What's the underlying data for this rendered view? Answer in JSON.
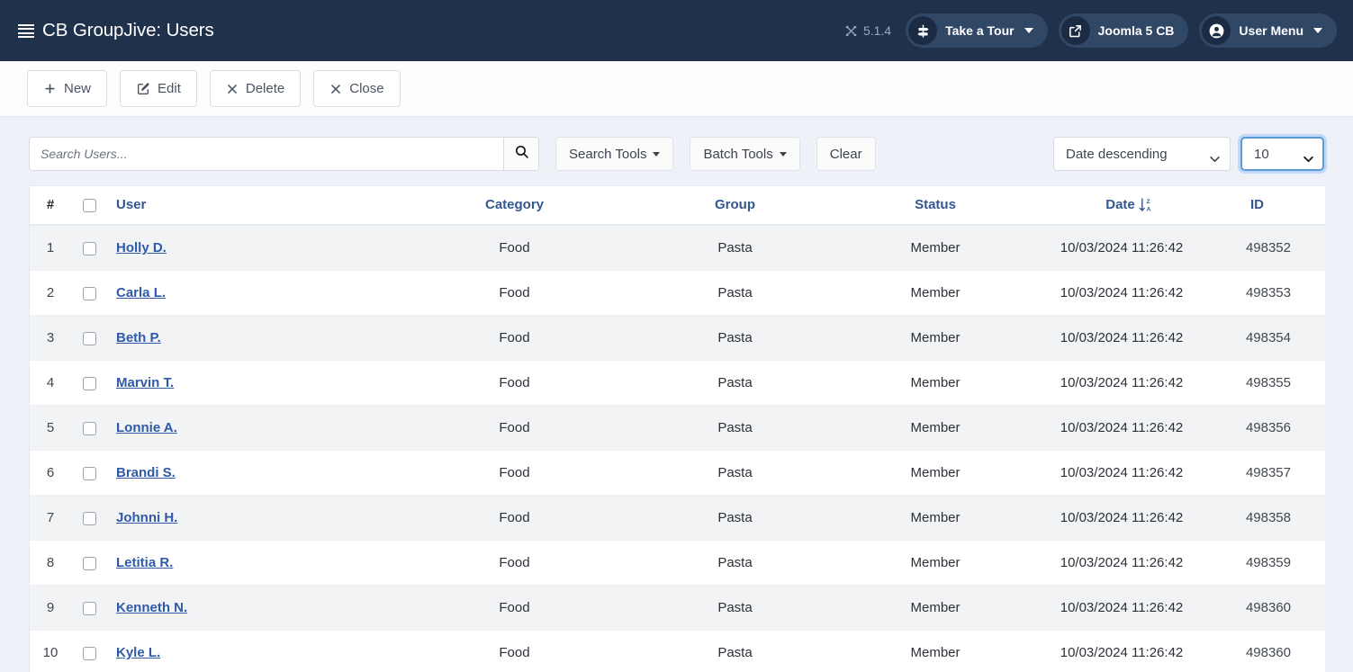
{
  "header": {
    "title": "CB GroupJive: Users",
    "menu_icon": "hamburger-icon",
    "version": "5.1.4",
    "pills": [
      {
        "label": "Take a Tour",
        "icon": "signpost-icon",
        "caret": true
      },
      {
        "label": "Joomla 5 CB",
        "icon": "external-link-icon",
        "caret": false
      },
      {
        "label": "User Menu",
        "icon": "user-circle-icon",
        "caret": true
      }
    ]
  },
  "toolbar": {
    "new_label": "New",
    "edit_label": "Edit",
    "delete_label": "Delete",
    "close_label": "Close"
  },
  "filters": {
    "search_value": "",
    "search_placeholder": "Search Users...",
    "search_button_icon": "search-icon",
    "search_tools_label": "Search Tools",
    "batch_tools_label": "Batch Tools",
    "clear_label": "Clear",
    "sort_selected": "Date descending",
    "sort_options": [
      "Date descending"
    ],
    "limit_selected": "10",
    "limit_options": [
      "10"
    ]
  },
  "table": {
    "columns": {
      "number": "#",
      "select_all": "",
      "user": "User",
      "category": "Category",
      "group": "Group",
      "status": "Status",
      "date": "Date",
      "id": "ID"
    },
    "sorted_column": "Date",
    "sort_direction": "descending",
    "sort_icon": "sort-z-a-icon",
    "rows": [
      {
        "num": "1",
        "user": "Holly D.",
        "category": "Food",
        "group": "Pasta",
        "status": "Member",
        "date": "10/03/2024 11:26:42",
        "id": "498352"
      },
      {
        "num": "2",
        "user": "Carla L.",
        "category": "Food",
        "group": "Pasta",
        "status": "Member",
        "date": "10/03/2024 11:26:42",
        "id": "498353"
      },
      {
        "num": "3",
        "user": "Beth P.",
        "category": "Food",
        "group": "Pasta",
        "status": "Member",
        "date": "10/03/2024 11:26:42",
        "id": "498354"
      },
      {
        "num": "4",
        "user": "Marvin T.",
        "category": "Food",
        "group": "Pasta",
        "status": "Member",
        "date": "10/03/2024 11:26:42",
        "id": "498355"
      },
      {
        "num": "5",
        "user": "Lonnie A.",
        "category": "Food",
        "group": "Pasta",
        "status": "Member",
        "date": "10/03/2024 11:26:42",
        "id": "498356"
      },
      {
        "num": "6",
        "user": "Brandi S.",
        "category": "Food",
        "group": "Pasta",
        "status": "Member",
        "date": "10/03/2024 11:26:42",
        "id": "498357"
      },
      {
        "num": "7",
        "user": "Johnni H.",
        "category": "Food",
        "group": "Pasta",
        "status": "Member",
        "date": "10/03/2024 11:26:42",
        "id": "498358"
      },
      {
        "num": "8",
        "user": "Letitia R.",
        "category": "Food",
        "group": "Pasta",
        "status": "Member",
        "date": "10/03/2024 11:26:42",
        "id": "498359"
      },
      {
        "num": "9",
        "user": "Kenneth N.",
        "category": "Food",
        "group": "Pasta",
        "status": "Member",
        "date": "10/03/2024 11:26:42",
        "id": "498360"
      },
      {
        "num": "10",
        "user": "Kyle L.",
        "category": "Food",
        "group": "Pasta",
        "status": "Member",
        "date": "10/03/2024 11:26:42",
        "id": "498360"
      }
    ]
  },
  "colors": {
    "header_bg": "#20314b",
    "pill_bg": "#314766",
    "link": "#2e5aa8",
    "column_header": "#34568f",
    "page_bg": "#eef1f8",
    "row_alt": "#f2f3f5",
    "focus_ring": "#6ea8fe"
  }
}
